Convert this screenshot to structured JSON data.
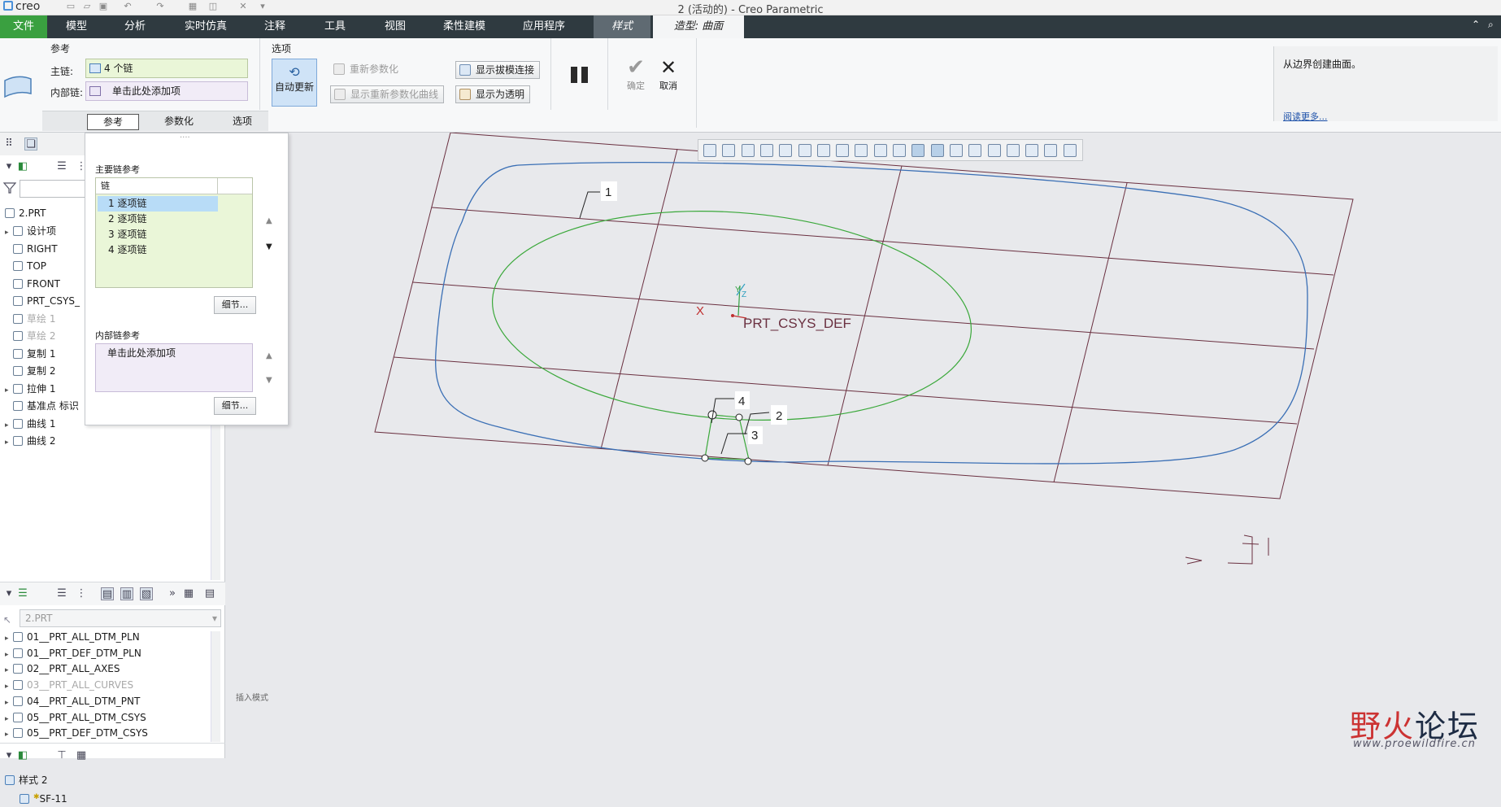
{
  "app": {
    "logo": "creo",
    "window_title": "2 (活动的) - Creo Parametric"
  },
  "menu": {
    "tabs": [
      "文件",
      "模型",
      "分析",
      "实时仿真",
      "注释",
      "工具",
      "视图",
      "柔性建模",
      "应用程序",
      "样式",
      "造型: 曲面"
    ]
  },
  "ribbon": {
    "ref_group": "参考",
    "main_chain_label": "主链:",
    "main_chain_value": "4 个链",
    "inner_chain_label": "内部链:",
    "inner_chain_value": "单击此处添加项",
    "options_group": "选项",
    "auto_update": "自动更新",
    "reparam": "重新参数化",
    "show_reparam_curves": "显示重新参数化曲线",
    "show_draft": "显示拔模连接",
    "show_transparent": "显示为透明",
    "ok": "确定",
    "cancel": "取消",
    "subtabs": [
      "参考",
      "参数化",
      "选项"
    ]
  },
  "help": {
    "text": "从边界创建曲面。",
    "link": "阅读更多..."
  },
  "model_tree": {
    "root": "2.PRT",
    "items": [
      {
        "label": "设计项",
        "dim": false
      },
      {
        "label": "RIGHT",
        "dim": false
      },
      {
        "label": "TOP",
        "dim": false
      },
      {
        "label": "FRONT",
        "dim": false
      },
      {
        "label": "PRT_CSYS_",
        "dim": false
      },
      {
        "label": "草绘 1",
        "dim": true
      },
      {
        "label": "草绘 2",
        "dim": true
      },
      {
        "label": "复制 1",
        "dim": false
      },
      {
        "label": "复制 2",
        "dim": false
      },
      {
        "label": "拉伸 1",
        "dim": false
      },
      {
        "label": "基准点 标识",
        "dim": false
      },
      {
        "label": "曲线 1",
        "dim": false
      },
      {
        "label": "曲线 2",
        "dim": false
      }
    ]
  },
  "layer_tree": {
    "combo": "2.PRT",
    "items": [
      {
        "label": "01__PRT_ALL_DTM_PLN",
        "dim": false
      },
      {
        "label": "01__PRT_DEF_DTM_PLN",
        "dim": false
      },
      {
        "label": "02__PRT_ALL_AXES",
        "dim": false
      },
      {
        "label": "03__PRT_ALL_CURVES",
        "dim": true
      },
      {
        "label": "04__PRT_ALL_DTM_PNT",
        "dim": false
      },
      {
        "label": "05__PRT_ALL_DTM_CSYS",
        "dim": false
      },
      {
        "label": "05__PRT_DEF_DTM_CSYS",
        "dim": false
      }
    ]
  },
  "style_tree": {
    "root": "样式 2",
    "child": "SF-11"
  },
  "ref_panel": {
    "main_title": "主要链参考",
    "col_header": "链",
    "chains": [
      "1 逐项链",
      "2 逐项链",
      "3 逐项链",
      "4 逐项链"
    ],
    "details": "细节...",
    "inner_title": "内部链参考",
    "inner_placeholder": "单击此处添加项"
  },
  "viewport": {
    "csys_label": "PRT_CSYS_DEF",
    "x_label": "X",
    "y_label": "Y",
    "z_label": "Z",
    "chain_labels": [
      "1",
      "2",
      "3",
      "4"
    ],
    "status": "插入模式"
  },
  "watermark": {
    "name_red": "野火",
    "name_dark": "论坛",
    "url": "www.proewildfire.cn"
  },
  "colors": {
    "menu_bg": "#2f3a40",
    "file_tab": "#3aa040",
    "curve_blue": "#3a6fb5",
    "curve_green": "#3aa83a",
    "plane": "#6a3040"
  }
}
